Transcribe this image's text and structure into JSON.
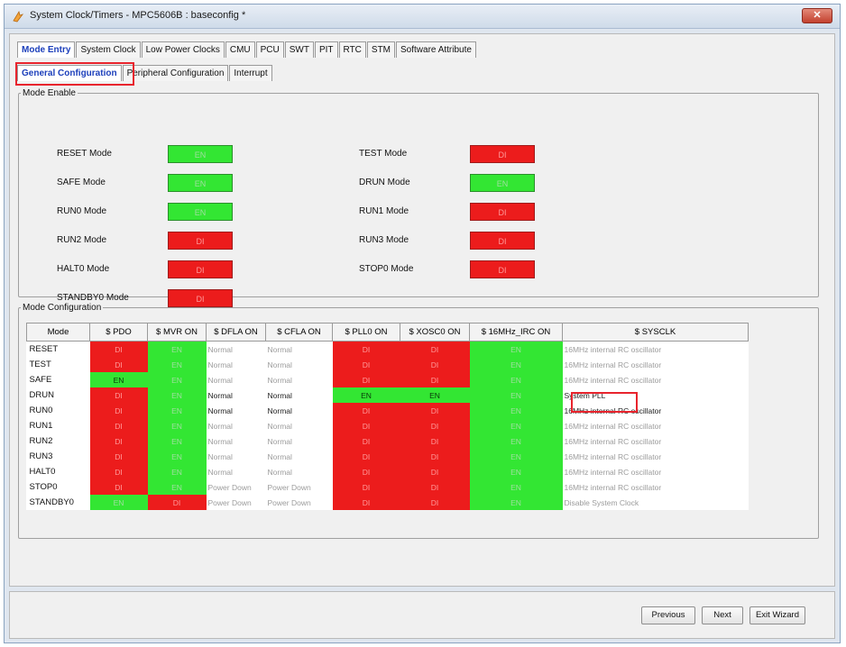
{
  "window": {
    "title": "System Clock/Timers - MPC5606B : baseconfig *",
    "close_label": "✕"
  },
  "tabs": [
    "Mode Entry",
    "System Clock",
    "Low Power Clocks",
    "CMU",
    "PCU",
    "SWT",
    "PIT",
    "RTC",
    "STM",
    "Software Attribute"
  ],
  "active_tab": "Mode Entry",
  "subtabs": [
    "General Configuration",
    "Peripheral Configuration",
    "Interrupt"
  ],
  "active_subtab": "General Configuration",
  "mode_enable": {
    "legend": "Mode Enable",
    "left": [
      {
        "label": "RESET Mode",
        "state": "EN"
      },
      {
        "label": "SAFE Mode",
        "state": "EN"
      },
      {
        "label": "RUN0 Mode",
        "state": "EN"
      },
      {
        "label": "RUN2 Mode",
        "state": "DI"
      },
      {
        "label": "HALT0 Mode",
        "state": "DI"
      },
      {
        "label": "STANDBY0 Mode",
        "state": "DI"
      }
    ],
    "right": [
      {
        "label": "TEST Mode",
        "state": "DI"
      },
      {
        "label": "DRUN Mode",
        "state": "EN"
      },
      {
        "label": "RUN1 Mode",
        "state": "DI"
      },
      {
        "label": "RUN3 Mode",
        "state": "DI"
      },
      {
        "label": "STOP0 Mode",
        "state": "DI"
      }
    ]
  },
  "mode_config": {
    "legend": "Mode Configuration",
    "columns": [
      "Mode",
      "$ PDO",
      "$ MVR ON",
      "$ DFLA ON",
      "$ CFLA ON",
      "$ PLL0 ON",
      "$ XOSC0 ON",
      "$ 16MHz_IRC ON",
      "$ SYSCLK"
    ],
    "rows": [
      {
        "mode": "RESET",
        "pdo": "DI",
        "mvr": "EN",
        "dfla": "Normal",
        "cfla": "Normal",
        "pll": "DI",
        "xosc": "DI",
        "irc": "EN",
        "sysclk": "16MHz internal RC oscillator"
      },
      {
        "mode": "TEST",
        "pdo": "DI",
        "mvr": "EN",
        "dfla": "Normal",
        "cfla": "Normal",
        "pll": "DI",
        "xosc": "DI",
        "irc": "EN",
        "sysclk": "16MHz internal RC oscillator"
      },
      {
        "mode": "SAFE",
        "pdo": "EN",
        "mvr": "EN",
        "dfla": "Normal",
        "cfla": "Normal",
        "pll": "DI",
        "xosc": "DI",
        "irc": "EN",
        "sysclk": "16MHz internal RC oscillator"
      },
      {
        "mode": "DRUN",
        "pdo": "DI",
        "mvr": "EN",
        "dfla": "Normal",
        "cfla": "Normal",
        "pll": "EN",
        "xosc": "EN",
        "irc": "EN",
        "sysclk": "System PLL"
      },
      {
        "mode": "RUN0",
        "pdo": "DI",
        "mvr": "EN",
        "dfla": "Normal",
        "cfla": "Normal",
        "pll": "DI",
        "xosc": "DI",
        "irc": "EN",
        "sysclk": "16MHz internal RC oscillator"
      },
      {
        "mode": "RUN1",
        "pdo": "DI",
        "mvr": "EN",
        "dfla": "Normal",
        "cfla": "Normal",
        "pll": "DI",
        "xosc": "DI",
        "irc": "EN",
        "sysclk": "16MHz internal RC oscillator"
      },
      {
        "mode": "RUN2",
        "pdo": "DI",
        "mvr": "EN",
        "dfla": "Normal",
        "cfla": "Normal",
        "pll": "DI",
        "xosc": "DI",
        "irc": "EN",
        "sysclk": "16MHz internal RC oscillator"
      },
      {
        "mode": "RUN3",
        "pdo": "DI",
        "mvr": "EN",
        "dfla": "Normal",
        "cfla": "Normal",
        "pll": "DI",
        "xosc": "DI",
        "irc": "EN",
        "sysclk": "16MHz internal RC oscillator"
      },
      {
        "mode": "HALT0",
        "pdo": "DI",
        "mvr": "EN",
        "dfla": "Normal",
        "cfla": "Normal",
        "pll": "DI",
        "xosc": "DI",
        "irc": "EN",
        "sysclk": "16MHz internal RC oscillator"
      },
      {
        "mode": "STOP0",
        "pdo": "DI",
        "mvr": "EN",
        "dfla": "Power Down",
        "cfla": "Power Down",
        "pll": "DI",
        "xosc": "DI",
        "irc": "EN",
        "sysclk": "16MHz internal RC oscillator"
      },
      {
        "mode": "STANDBY0",
        "pdo": "EN",
        "mvr": "DI",
        "dfla": "Power Down",
        "cfla": "Power Down",
        "pll": "DI",
        "xosc": "DI",
        "irc": "EN",
        "sysclk": "Disable System Clock"
      }
    ]
  },
  "buttons": {
    "previous": "Previous",
    "next": "Next",
    "exit": "Exit Wizard"
  },
  "colors": {
    "enabled": "#33e633",
    "disabled": "#ec1c1c",
    "highlight": "#e8242d",
    "active_tab": "#1c3fbb"
  }
}
